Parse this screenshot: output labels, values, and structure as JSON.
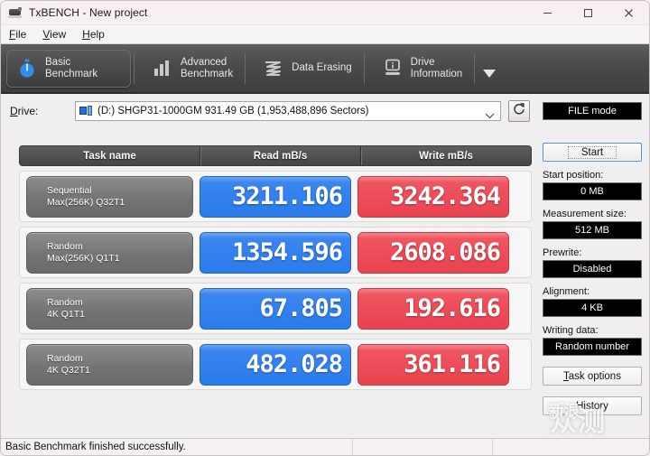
{
  "window": {
    "title": "TxBENCH - New project",
    "icon": "app-icon",
    "minimize": "─",
    "maximize": "□",
    "close": "✕"
  },
  "menubar": {
    "items": [
      {
        "label": "File",
        "accel": "F"
      },
      {
        "label": "View",
        "accel": "V"
      },
      {
        "label": "Help",
        "accel": "H"
      }
    ]
  },
  "toolbar": {
    "tabs": [
      {
        "label": "Basic\nBenchmark",
        "icon": "stopwatch-icon",
        "active": true
      },
      {
        "label": "Advanced\nBenchmark",
        "icon": "bar-chart-icon",
        "active": false
      },
      {
        "label": "Data Erasing",
        "icon": "shred-icon",
        "active": false
      },
      {
        "label": "Drive\nInformation",
        "icon": "drive-info-icon",
        "active": false
      }
    ],
    "overflow_icon": "chevron-down-icon"
  },
  "drive": {
    "label": "Drive:",
    "value": "(D:) SHGP31-1000GM  931.49 GB (1,953,488,896 Sectors)",
    "dropdown_icon": "chevron-down-icon",
    "refresh_icon": "refresh-icon"
  },
  "table": {
    "headers": {
      "task": "Task name",
      "read": "Read mB/s",
      "write": "Write mB/s"
    },
    "rows": [
      {
        "name_line1": "Sequential",
        "name_line2": "Max(256K) Q32T1",
        "read": "3211.106",
        "write": "3242.364"
      },
      {
        "name_line1": "Random",
        "name_line2": "Max(256K) Q1T1",
        "read": "1354.596",
        "write": "2608.086"
      },
      {
        "name_line1": "Random",
        "name_line2": "4K Q1T1",
        "read": "67.805",
        "write": "192.616"
      },
      {
        "name_line1": "Random",
        "name_line2": "4K Q32T1",
        "read": "482.028",
        "write": "361.116"
      }
    ]
  },
  "sidebar": {
    "mode_button": "FILE mode",
    "start_button": "Start",
    "fields": [
      {
        "label": "Start position:",
        "value": "0 MB"
      },
      {
        "label": "Measurement size:",
        "value": "512 MB"
      },
      {
        "label": "Prewrite:",
        "value": "Disabled"
      },
      {
        "label": "Alignment:",
        "value": "4 KB"
      },
      {
        "label": "Writing data:",
        "value": "Random number"
      }
    ],
    "task_options_button": "Task options",
    "history_button": "History"
  },
  "statusbar": {
    "message": "Basic Benchmark finished successfully.",
    "panel2": "",
    "panel3": ""
  },
  "watermark": {
    "main": "众测",
    "small": "新浪"
  },
  "colors": {
    "read_blue": "#2a7bec",
    "write_red": "#e8434f",
    "toolbar_dark": "#4a4a4a",
    "field_black": "#000000"
  }
}
